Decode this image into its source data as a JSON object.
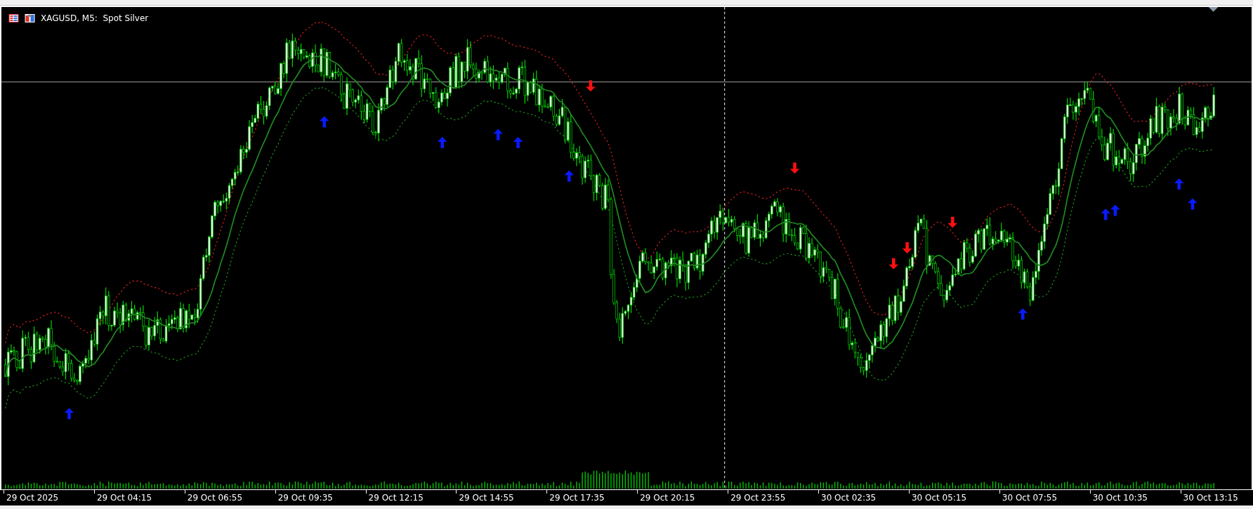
{
  "window": {
    "title": "XAGUSD, M5:  Spot Silver"
  },
  "time_axis": {
    "labels": [
      "29 Oct 2025",
      "29 Oct 04:15",
      "29 Oct 06:55",
      "29 Oct 09:35",
      "29 Oct 12:15",
      "29 Oct 14:55",
      "29 Oct 17:35",
      "29 Oct 20:15",
      "29 Oct 23:55",
      "30 Oct 02:35",
      "30 Oct 05:15",
      "30 Oct 07:55",
      "30 Oct 10:35",
      "30 Oct 13:15"
    ]
  }
}
